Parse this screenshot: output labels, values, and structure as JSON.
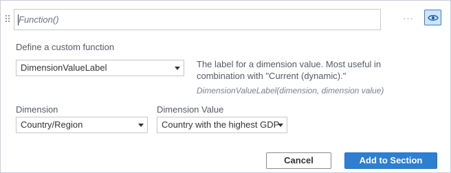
{
  "function_input": {
    "value": "Function()"
  },
  "more_label": "···",
  "custom_function": {
    "label": "Define a custom function",
    "selected": "DimensionValueLabel",
    "description": "The label for a dimension value. Most useful in combination with \"Current (dynamic).\"",
    "syntax": "DimensionValueLabel(dimension, dimension value)"
  },
  "dimension": {
    "label": "Dimension",
    "selected": "Country/Region"
  },
  "dimension_value": {
    "label": "Dimension Value",
    "selected": "Country with the highest GDP"
  },
  "actions": {
    "cancel_label": "Cancel",
    "add_label": "Add to Section"
  },
  "icons": {
    "drag": "drag-handle-icon",
    "more": "more-icon",
    "eye": "eye-icon",
    "dropdown": "chevron-down-icon"
  },
  "colors": {
    "accent": "#2f7fd0",
    "accent_light": "#cfe4f8",
    "border": "#c8cce0"
  }
}
